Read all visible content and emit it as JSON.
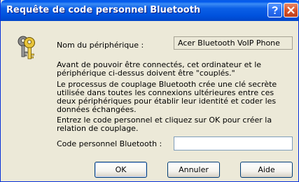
{
  "window": {
    "title": "Requête de code personnel Bluetooth",
    "help_button_label": "?",
    "close_button_label": "X"
  },
  "device": {
    "label": "Nom du périphérique :",
    "value": "Acer Bluetooth VoIP Phone"
  },
  "paragraphs": {
    "p1": "Avant de pouvoir être connectés, cet ordinateur et le périphérique ci-dessus doivent être \"couplés.\"",
    "p2": "Le processus de couplage Bluetooth crée une clé secrète utilisée dans toutes les connexions ultérieures entre ces deux périphériques pour établir leur identité et coder les données échangées.",
    "p3": "Entrez le code personnel et cliquez sur OK pour créer la relation de couplage."
  },
  "code": {
    "label": "Code personnel Bluetooth :",
    "value": ""
  },
  "buttons": {
    "ok": "OK",
    "cancel": "Annuler",
    "help": "Aide"
  },
  "icons": {
    "dialog_icon": "keys-icon"
  },
  "colors": {
    "titlebar": "#0058ee",
    "dialog_bg": "#ece9d8",
    "close_button": "#d8532a"
  }
}
